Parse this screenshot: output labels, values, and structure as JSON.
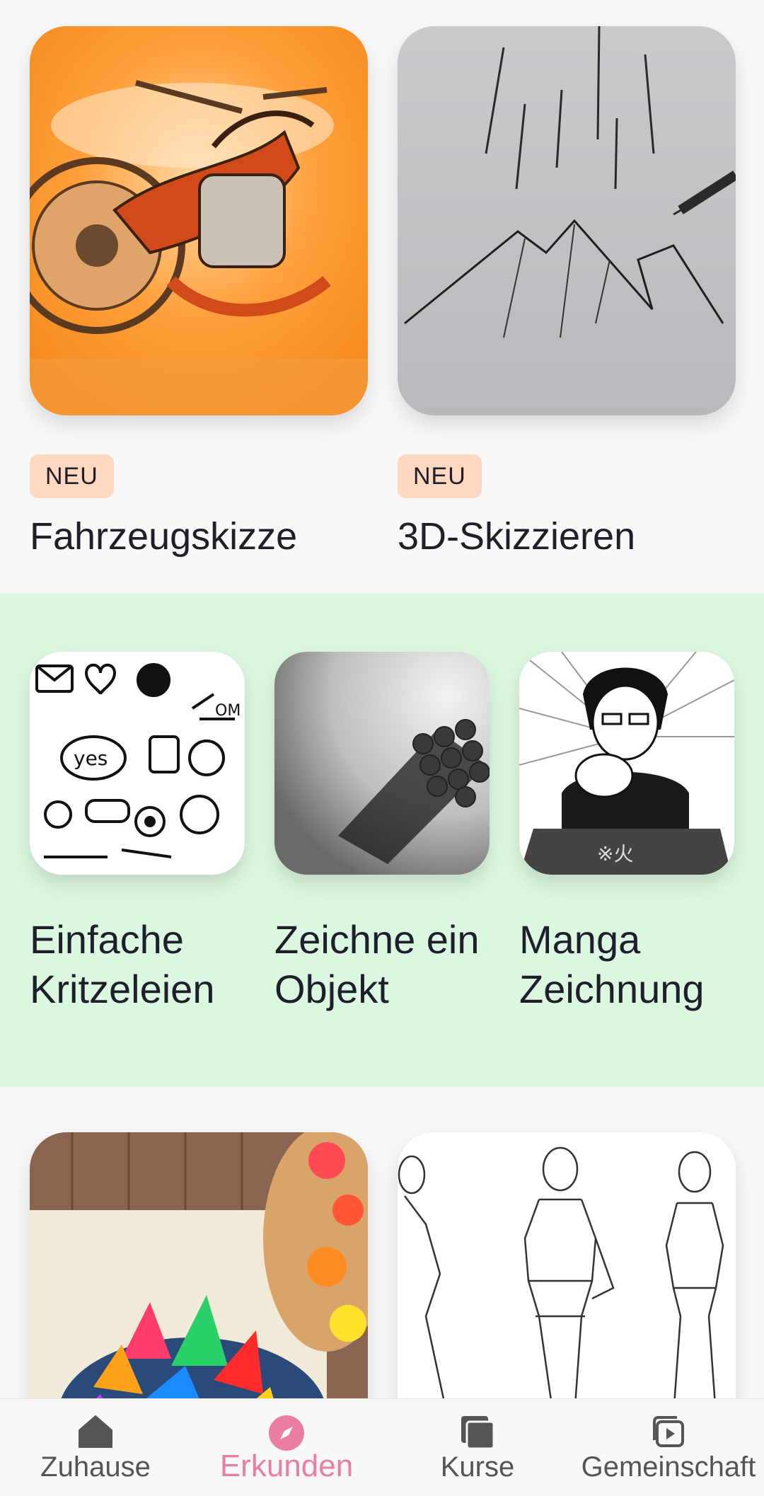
{
  "featured": [
    {
      "badge": "NEU",
      "title": "Fahrzeugskizze"
    },
    {
      "badge": "NEU",
      "title": "3D-Skizzieren"
    }
  ],
  "green_section": {
    "items": [
      {
        "title": "Einfache\nKritzeleien"
      },
      {
        "title": "Zeichne ein\nObjekt"
      },
      {
        "title": "Manga\nZeichnung"
      }
    ],
    "background": "#dcf7e0"
  },
  "bottom_cards": [
    {
      "image": "succulent-painting"
    },
    {
      "image": "fashion-figure-sketch"
    }
  ],
  "bottom_nav": {
    "items": [
      {
        "label": "Zuhause",
        "icon": "home-icon"
      },
      {
        "label": "Erkunden",
        "icon": "compass-icon",
        "active": true
      },
      {
        "label": "Kurse",
        "icon": "courses-icon"
      },
      {
        "label": "Gemeinschaft",
        "icon": "community-icon"
      }
    ],
    "accent": "#e97ea0"
  },
  "colors": {
    "badge_bg": "#ffd8c2",
    "text": "#1f1f2b"
  }
}
